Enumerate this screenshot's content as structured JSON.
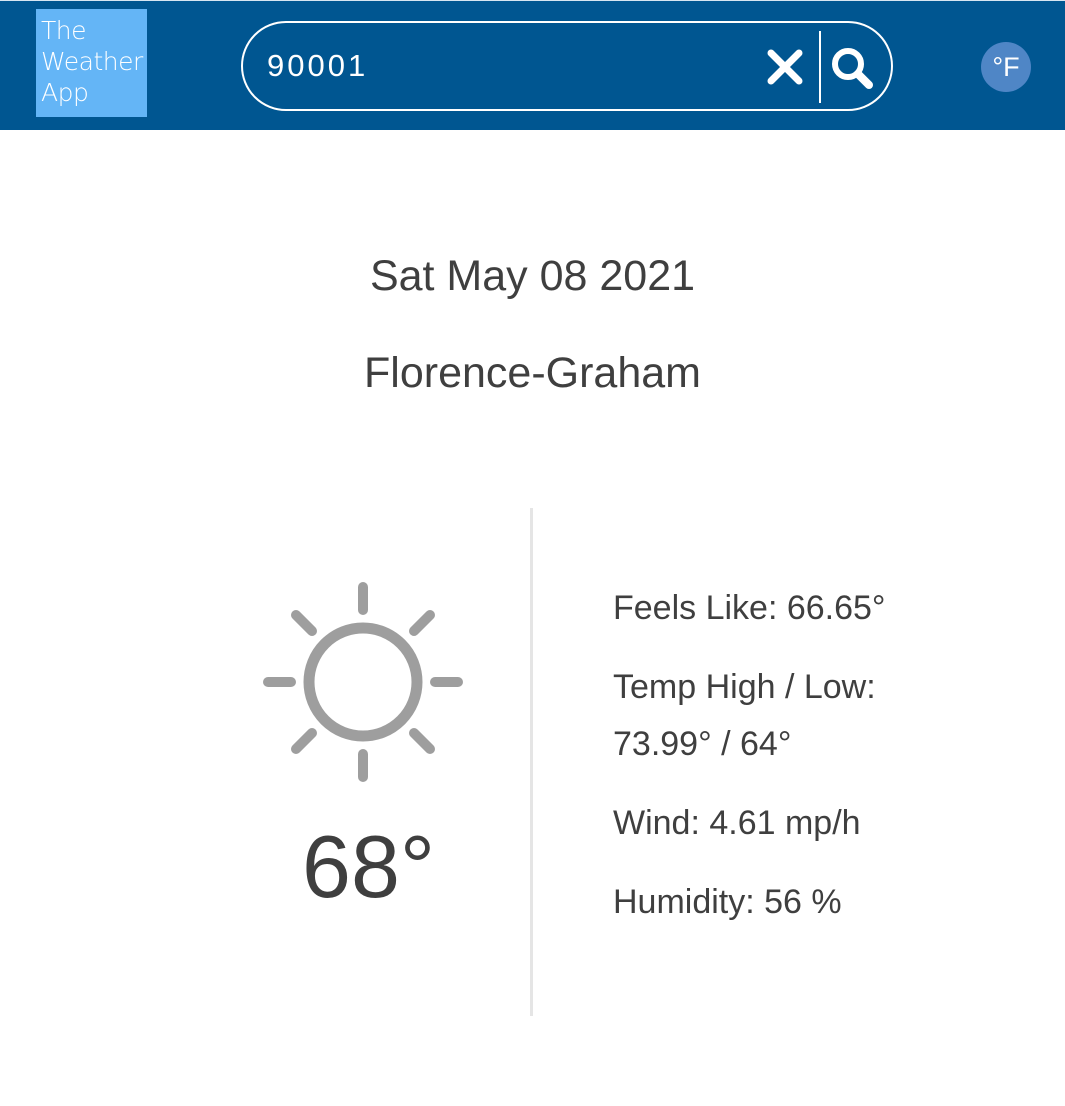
{
  "header": {
    "logo_lines": [
      "The",
      "Weather",
      "App"
    ],
    "search": {
      "value": "90001",
      "clear_icon": "close-icon",
      "search_icon": "search-icon"
    },
    "unit_toggle": "°F"
  },
  "colors": {
    "header_bg": "#005691",
    "logo_bg": "#64b5f6",
    "unit_bg": "#4f86c6",
    "text": "#3f3f3f",
    "icon_gray": "#9e9e9e"
  },
  "main": {
    "date": "Sat May 08 2021",
    "city": "Florence-Graham",
    "weather_icon": "sun-icon",
    "temperature": "68°",
    "feels_like": "Feels Like: 66.65°",
    "temp_high_low_label": "Temp High / Low:",
    "temp_high_low_value": "73.99° / 64°",
    "wind": "Wind: 4.61 mp/h",
    "humidity": "Humidity: 56 %"
  }
}
